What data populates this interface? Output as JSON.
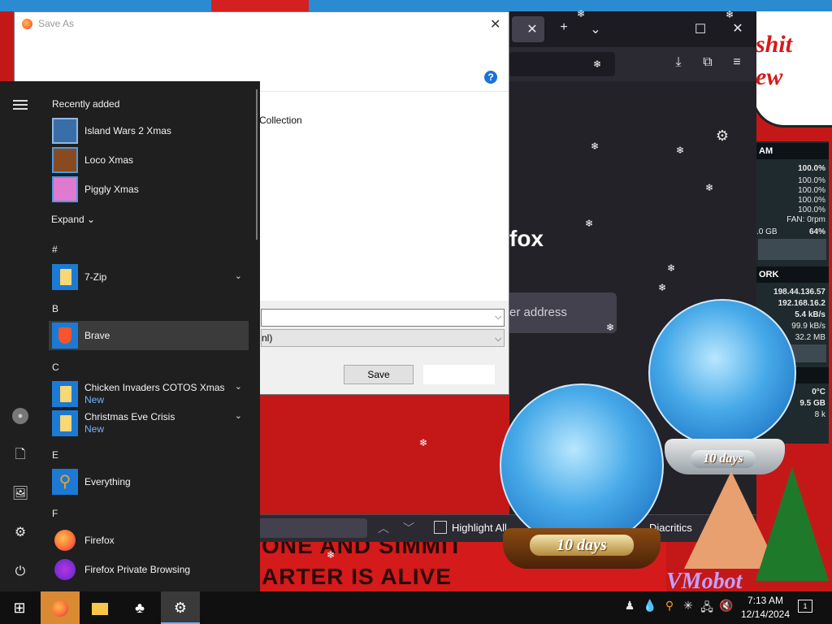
{
  "desktop": {
    "speech_text": "shit\new",
    "banner_line1": "ONE AND SIMMIT",
    "banner_line2": "ARTER IS ALIVE",
    "vmobot": "VMobot"
  },
  "firefox": {
    "brand_fragment": "fox",
    "search_placeholder": "er address",
    "findbar": {
      "highlight_all_label": "Highlight All",
      "diacritics_label": "Diacritics"
    }
  },
  "system_monitor": {
    "cpu_header": "AM",
    "cpu_total": "100.0%",
    "cores": [
      "100.0%",
      "100.0%",
      "100.0%",
      "100.0%"
    ],
    "fan": "FAN: 0rpm",
    "mem_used": ".0 GB",
    "mem_pct": "64%",
    "net_header": "ORK",
    "ip_public": "198.44.136.57",
    "ip_local": "192.168.16.2",
    "down_rate": "5.4 kB/s",
    "up_rate": "99.9 kB/s",
    "total": "32.2 MB",
    "temp": "0°C",
    "disk": "9.5 GB",
    "disk_rate": "8 k"
  },
  "dialog": {
    "title": "Save As",
    "help": "?",
    "visible_item": "Collection",
    "filename_value": "",
    "filetype_value": "nl)",
    "save_label": "Save"
  },
  "start_menu": {
    "recently_added_heading": "Recently added",
    "recent": [
      {
        "label": "Island Wars 2 Xmas"
      },
      {
        "label": "Loco Xmas"
      },
      {
        "label": "Piggly Xmas"
      }
    ],
    "expand_label": "Expand",
    "letters": {
      "hash": "#",
      "b": "B",
      "c": "C",
      "e": "E",
      "f": "F"
    },
    "apps": {
      "sevenzip": "7-Zip",
      "brave": "Brave",
      "chicken": "Chicken Invaders COTOS Xmas",
      "chicken_sub": "New",
      "christmas": "Christmas Eve Crisis",
      "christmas_sub": "New",
      "everything": "Everything",
      "firefox": "Firefox",
      "firefox_private": "Firefox Private Browsing"
    }
  },
  "globes": {
    "left_plaque": "10 days",
    "right_plaque": "10 days"
  },
  "taskbar": {
    "time": "7:13 AM",
    "date": "12/14/2024",
    "notification_count": "1"
  },
  "colors": {
    "accent": "#6ab0ff",
    "new_badge": "#6eb6ff",
    "start_bg": "#1f1f1f",
    "firefox_bg": "#232228"
  }
}
